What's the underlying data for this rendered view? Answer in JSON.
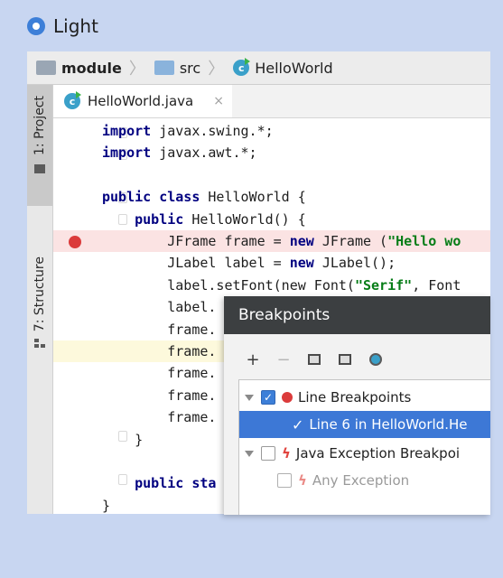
{
  "theme_option": {
    "label": "Light",
    "selected": true
  },
  "navbar": {
    "crumbs": [
      "module",
      "src",
      "HelloWorld"
    ]
  },
  "sidebar": {
    "tabs": [
      "1: Project",
      "7: Structure"
    ]
  },
  "editor": {
    "tab_label": "HelloWorld.java",
    "close_glyph": "×",
    "lines": [
      {
        "parts": [
          {
            "t": "import",
            "k": "kw"
          },
          {
            "t": " javax.swing.*;"
          }
        ]
      },
      {
        "parts": [
          {
            "t": "import",
            "k": "kw"
          },
          {
            "t": " javax.awt.*;"
          }
        ]
      },
      {
        "parts": []
      },
      {
        "parts": [
          {
            "t": "public class",
            "k": "kw"
          },
          {
            "t": " HelloWorld {"
          }
        ]
      },
      {
        "parts": [
          {
            "t": "    "
          },
          {
            "t": "public",
            "k": "kw"
          },
          {
            "t": " HelloWorld() {"
          }
        ]
      },
      {
        "parts": [
          {
            "t": "        JFrame frame = "
          },
          {
            "t": "new",
            "k": "kw"
          },
          {
            "t": " JFrame ("
          },
          {
            "t": "\"Hello wo",
            "k": "str"
          }
        ]
      },
      {
        "parts": [
          {
            "t": "        JLabel label = "
          },
          {
            "t": "new",
            "k": "kw"
          },
          {
            "t": " JLabel();"
          }
        ]
      },
      {
        "parts": [
          {
            "t": "        label.setFont(new Font("
          },
          {
            "t": "\"Serif\"",
            "k": "str"
          },
          {
            "t": ", Font"
          }
        ]
      },
      {
        "parts": [
          {
            "t": "        label."
          }
        ]
      },
      {
        "parts": [
          {
            "t": "        frame."
          }
        ]
      },
      {
        "parts": [
          {
            "t": "        frame."
          }
        ]
      },
      {
        "parts": [
          {
            "t": "        frame."
          }
        ]
      },
      {
        "parts": [
          {
            "t": "        frame."
          }
        ]
      },
      {
        "parts": [
          {
            "t": "        frame."
          }
        ]
      },
      {
        "parts": [
          {
            "t": "    }"
          }
        ]
      },
      {
        "parts": []
      },
      {
        "parts": [
          {
            "t": "    "
          },
          {
            "t": "public sta",
            "k": "kw"
          }
        ]
      },
      {
        "parts": [
          {
            "t": "}"
          }
        ]
      }
    ]
  },
  "breakpoints_dialog": {
    "title": "Breakpoints",
    "toolbar": [
      "+",
      "−"
    ],
    "rows": [
      {
        "label": "Line Breakpoints",
        "checked": true
      },
      {
        "label": "Line 6 in HelloWorld.He",
        "checked": true,
        "selected": true
      },
      {
        "label": "Java Exception Breakpoi",
        "checked": false
      },
      {
        "label": "Any Exception",
        "checked": false,
        "disabled": true
      }
    ]
  },
  "colors": {
    "background": "#c8d6f1",
    "accent": "#3d7fd8",
    "breakpoint": "#db3b3b"
  }
}
